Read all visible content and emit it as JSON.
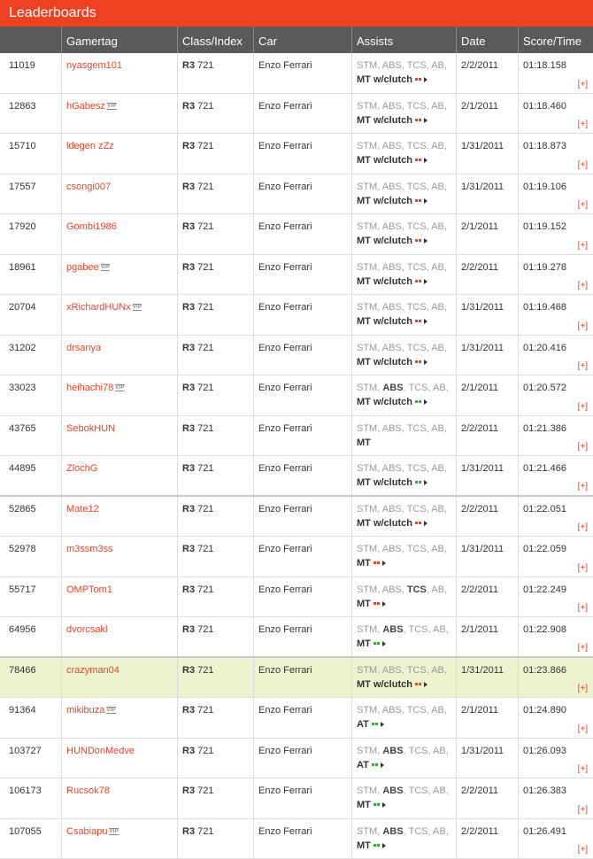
{
  "title": "Leaderboards",
  "columns": [
    "",
    "Gamertag",
    "Class/Index",
    "Car",
    "Assists",
    "Date",
    "Score/Time"
  ],
  "expand_label": "[+]",
  "assist_labels": [
    "STM",
    "ABS",
    "TCS",
    "AB"
  ],
  "colors": {
    "accent": "#ee4122",
    "header": "#5a5a5a",
    "highlight": "#eef3cf",
    "arrow_red": "#e8442a",
    "arrow_green": "#3ca63c"
  },
  "rows": [
    {
      "rank": "11019",
      "tag": "nyasgem101",
      "xbox": false,
      "cls": "R3",
      "idx": "721",
      "car": "Enzo Ferrari",
      "on": [],
      "trans": "MT w/clutch",
      "arrow": "red",
      "date": "2/2/2011",
      "time": "01:18.158"
    },
    {
      "rank": "12863",
      "tag": "hGabesz",
      "xbox": true,
      "cls": "R3",
      "idx": "721",
      "car": "Enzo Ferrari",
      "on": [],
      "trans": "MT w/clutch",
      "arrow": "red",
      "date": "2/1/2011",
      "time": "01:18.460"
    },
    {
      "rank": "15710",
      "tag": "ldegen zZz",
      "xbox": false,
      "cls": "R3",
      "idx": "721",
      "car": "Enzo Ferrari",
      "on": [],
      "trans": "MT w/clutch",
      "arrow": "red",
      "date": "1/31/2011",
      "time": "01:18.873"
    },
    {
      "rank": "17557",
      "tag": "csongi007",
      "xbox": false,
      "cls": "R3",
      "idx": "721",
      "car": "Enzo Ferrari",
      "on": [],
      "trans": "MT w/clutch",
      "arrow": "red",
      "date": "1/31/2011",
      "time": "01:19.106"
    },
    {
      "rank": "17920",
      "tag": "Gombi1986",
      "xbox": false,
      "cls": "R3",
      "idx": "721",
      "car": "Enzo Ferrari",
      "on": [],
      "trans": "MT w/clutch",
      "arrow": "red",
      "date": "2/1/2011",
      "time": "01:19.152"
    },
    {
      "rank": "18961",
      "tag": "pgabee",
      "xbox": true,
      "cls": "R3",
      "idx": "721",
      "car": "Enzo Ferrari",
      "on": [],
      "trans": "MT w/clutch",
      "arrow": "red",
      "date": "2/2/2011",
      "time": "01:19.278"
    },
    {
      "rank": "20704",
      "tag": "xRichardHUNx",
      "xbox": true,
      "cls": "R3",
      "idx": "721",
      "car": "Enzo Ferrari",
      "on": [],
      "trans": "MT w/clutch",
      "arrow": "red",
      "date": "1/31/2011",
      "time": "01:19.468"
    },
    {
      "rank": "31202",
      "tag": "drsanya",
      "xbox": false,
      "cls": "R3",
      "idx": "721",
      "car": "Enzo Ferrari",
      "on": [],
      "trans": "MT w/clutch",
      "arrow": "red",
      "date": "1/31/2011",
      "time": "01:20.416"
    },
    {
      "rank": "33023",
      "tag": "heihachi78",
      "xbox": true,
      "cls": "R3",
      "idx": "721",
      "car": "Enzo Ferrari",
      "on": [
        "ABS"
      ],
      "trans": "MT w/clutch",
      "arrow": "green",
      "date": "2/1/2011",
      "time": "01:20.572"
    },
    {
      "rank": "43765",
      "tag": "SebokHUN",
      "xbox": false,
      "cls": "R3",
      "idx": "721",
      "car": "Enzo Ferrari",
      "on": [],
      "trans": "MT",
      "arrow": "none",
      "date": "2/2/2011",
      "time": "01:21.386"
    },
    {
      "rank": "44895",
      "tag": "ZlochG",
      "xbox": false,
      "cls": "R3",
      "idx": "721",
      "car": "Enzo Ferrari",
      "on": [],
      "trans": "MT w/clutch",
      "arrow": "green",
      "date": "1/31/2011",
      "time": "01:21.466"
    },
    {
      "rank": "52865",
      "tag": "Mate12",
      "xbox": false,
      "cls": "R3",
      "idx": "721",
      "car": "Enzo Ferrari",
      "on": [],
      "trans": "MT w/clutch",
      "arrow": "red",
      "date": "2/2/2011",
      "time": "01:22.051"
    },
    {
      "rank": "52978",
      "tag": "m3ssm3ss",
      "xbox": false,
      "cls": "R3",
      "idx": "721",
      "car": "Enzo Ferrari",
      "on": [],
      "trans": "MT",
      "arrow": "red",
      "date": "1/31/2011",
      "time": "01:22.059"
    },
    {
      "rank": "55717",
      "tag": "OMPTom1",
      "xbox": false,
      "cls": "R3",
      "idx": "721",
      "car": "Enzo Ferrari",
      "on": [
        "TCS"
      ],
      "trans": "MT",
      "arrow": "red",
      "date": "2/2/2011",
      "time": "01:22.249"
    },
    {
      "rank": "64956",
      "tag": "dvorcsakl",
      "xbox": false,
      "cls": "R3",
      "idx": "721",
      "car": "Enzo Ferrari",
      "on": [
        "ABS"
      ],
      "trans": "MT",
      "arrow": "green",
      "date": "2/1/2011",
      "time": "01:22.908"
    },
    {
      "rank": "78466",
      "tag": "crazyman04",
      "xbox": false,
      "cls": "R3",
      "idx": "721",
      "car": "Enzo Ferrari",
      "on": [],
      "trans": "MT w/clutch",
      "arrow": "red",
      "date": "1/31/2011",
      "time": "01:23.866",
      "highlight": true
    },
    {
      "rank": "91364",
      "tag": "mikibuza",
      "xbox": true,
      "cls": "R3",
      "idx": "721",
      "car": "Enzo Ferrari",
      "on": [],
      "trans": "AT",
      "arrow": "green",
      "date": "2/1/2011",
      "time": "01:24.890"
    },
    {
      "rank": "103727",
      "tag": "HUNDonMedve",
      "xbox": false,
      "cls": "R3",
      "idx": "721",
      "car": "Enzo Ferrari",
      "on": [
        "ABS"
      ],
      "trans": "AT",
      "arrow": "green",
      "date": "1/31/2011",
      "time": "01:26.093"
    },
    {
      "rank": "106173",
      "tag": "Rucsok78",
      "xbox": false,
      "cls": "R3",
      "idx": "721",
      "car": "Enzo Ferrari",
      "on": [
        "ABS"
      ],
      "trans": "MT",
      "arrow": "green",
      "date": "2/2/2011",
      "time": "01:26.383"
    },
    {
      "rank": "107055",
      "tag": "Csabiapu",
      "xbox": true,
      "cls": "R3",
      "idx": "721",
      "car": "Enzo Ferrari",
      "on": [
        "ABS"
      ],
      "trans": "MT",
      "arrow": "green",
      "date": "2/2/2011",
      "time": "01:26.491"
    }
  ]
}
